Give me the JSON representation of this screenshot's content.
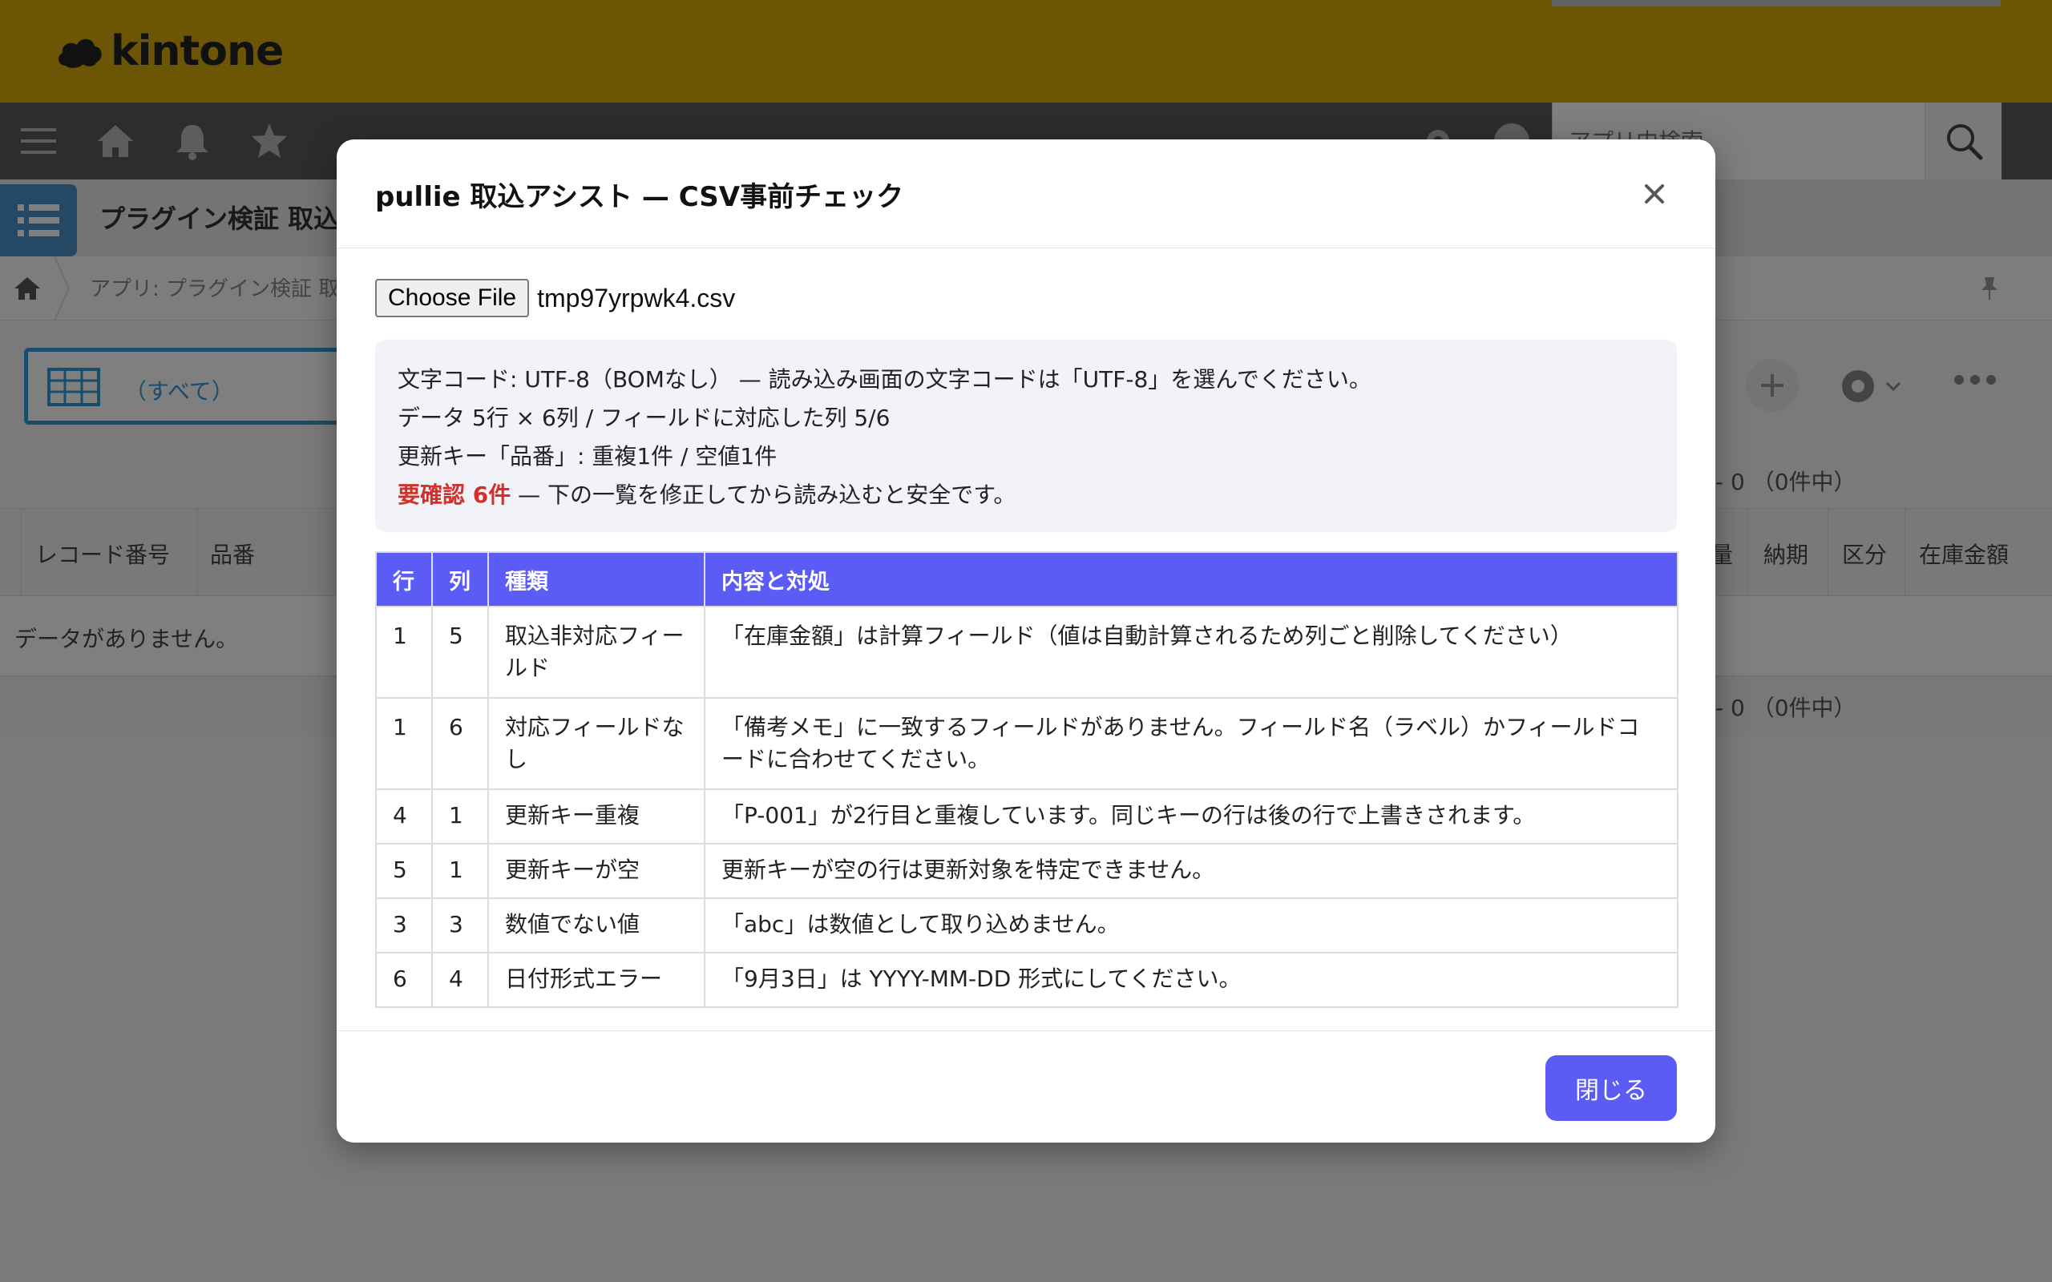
{
  "header": {
    "logo_text": "kintone",
    "search_placeholder": "アプリ内検索",
    "brand_color": "#d9aa0b"
  },
  "app": {
    "title": "プラグイン検証 取込",
    "breadcrumb": "アプリ: プラグイン検証 取込"
  },
  "view": {
    "selected": "（すべて）"
  },
  "list": {
    "pager_top": "- 0 （0件中）",
    "pager_bottom": "- 0 （0件中）",
    "columns_left": [
      "レコード番号",
      "品番"
    ],
    "columns_right": [
      "量",
      "納期",
      "区分",
      "在庫金額"
    ],
    "empty_message": "データがありません。"
  },
  "modal": {
    "title": "pullie 取込アシスト — CSV事前チェック",
    "close_icon": "close-icon",
    "file_button": "Choose File",
    "file_name": "tmp97yrpwk4.csv",
    "summary": {
      "encoding": "文字コード: UTF-8（BOMなし） — 読み込み画面の文字コードは「UTF-8」を選んでください。",
      "shape": "データ 5行 × 6列 / フィールドに対応した列 5/6",
      "key": "更新キー「品番」: 重複1件 / 空値1件",
      "warn_label": "要確認 6件",
      "warn_rest": " — 下の一覧を修正してから読み込むと安全です。"
    },
    "table": {
      "headers": [
        "行",
        "列",
        "種類",
        "内容と対処"
      ],
      "rows": [
        {
          "row": "1",
          "col": "5",
          "type": "取込非対応フィールド",
          "detail": "「在庫金額」は計算フィールド（値は自動計算されるため列ごと削除してください）"
        },
        {
          "row": "1",
          "col": "6",
          "type": "対応フィールドなし",
          "detail": "「備考メモ」に一致するフィールドがありません。フィールド名（ラベル）かフィールドコードに合わせてください。"
        },
        {
          "row": "4",
          "col": "1",
          "type": "更新キー重複",
          "detail": "「P-001」が2行目と重複しています。同じキーの行は後の行で上書きされます。"
        },
        {
          "row": "5",
          "col": "1",
          "type": "更新キーが空",
          "detail": "更新キーが空の行は更新対象を特定できません。"
        },
        {
          "row": "3",
          "col": "3",
          "type": "数値でない値",
          "detail": "「abc」は数値として取り込めません。"
        },
        {
          "row": "6",
          "col": "4",
          "type": "日付形式エラー",
          "detail": "「9月3日」は YYYY-MM-DD 形式にしてください。"
        }
      ]
    },
    "close_button": "閉じる",
    "accent_color": "#5b5bf5",
    "warn_color": "#d0312d"
  }
}
